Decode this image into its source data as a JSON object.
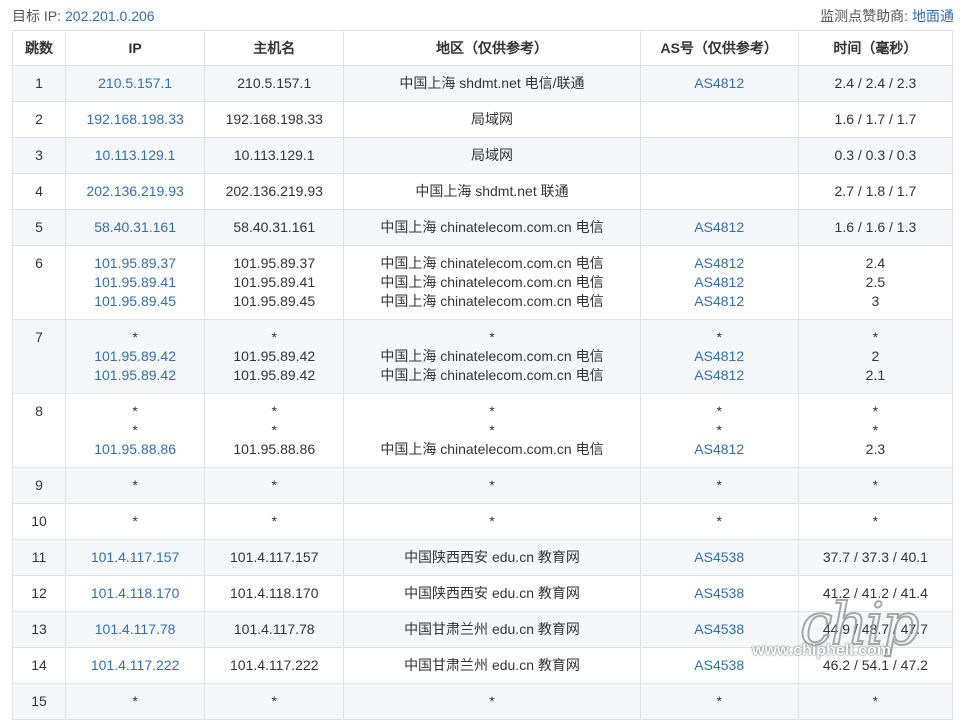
{
  "header": {
    "target_label": "目标 IP:",
    "target_ip": "202.201.0.206",
    "sponsor_label": "监测点赞助商:",
    "sponsor_name": "地面通"
  },
  "columns": [
    "跳数",
    "IP",
    "主机名",
    "地区（仅供参考）",
    "AS号（仅供参考）",
    "时间（毫秒）"
  ],
  "rows": [
    {
      "hop": "1",
      "lines": [
        {
          "ip": "210.5.157.1",
          "host": "210.5.157.1",
          "region": "中国上海 shdmt.net 电信/联通",
          "as": "AS4812",
          "time": "2.4 / 2.4 / 2.3"
        }
      ]
    },
    {
      "hop": "2",
      "lines": [
        {
          "ip": "192.168.198.33",
          "host": "192.168.198.33",
          "region": "局域网",
          "as": "",
          "time": "1.6 / 1.7 / 1.7"
        }
      ]
    },
    {
      "hop": "3",
      "lines": [
        {
          "ip": "10.113.129.1",
          "host": "10.113.129.1",
          "region": "局域网",
          "as": "",
          "time": "0.3 / 0.3 / 0.3"
        }
      ]
    },
    {
      "hop": "4",
      "lines": [
        {
          "ip": "202.136.219.93",
          "host": "202.136.219.93",
          "region": "中国上海 shdmt.net 联通",
          "as": "",
          "time": "2.7 / 1.8 / 1.7"
        }
      ]
    },
    {
      "hop": "5",
      "lines": [
        {
          "ip": "58.40.31.161",
          "host": "58.40.31.161",
          "region": "中国上海 chinatelecom.com.cn 电信",
          "as": "AS4812",
          "time": "1.6 / 1.6 / 1.3"
        }
      ]
    },
    {
      "hop": "6",
      "lines": [
        {
          "ip": "101.95.89.37",
          "host": "101.95.89.37",
          "region": "中国上海 chinatelecom.com.cn 电信",
          "as": "AS4812",
          "time": "2.4"
        },
        {
          "ip": "101.95.89.41",
          "host": "101.95.89.41",
          "region": "中国上海 chinatelecom.com.cn 电信",
          "as": "AS4812",
          "time": "2.5"
        },
        {
          "ip": "101.95.89.45",
          "host": "101.95.89.45",
          "region": "中国上海 chinatelecom.com.cn 电信",
          "as": "AS4812",
          "time": "3"
        }
      ]
    },
    {
      "hop": "7",
      "lines": [
        {
          "ip": "*",
          "host": "*",
          "region": "*",
          "as": "*",
          "time": "*"
        },
        {
          "ip": "101.95.89.42",
          "host": "101.95.89.42",
          "region": "中国上海 chinatelecom.com.cn 电信",
          "as": "AS4812",
          "time": "2"
        },
        {
          "ip": "101.95.89.42",
          "host": "101.95.89.42",
          "region": "中国上海 chinatelecom.com.cn 电信",
          "as": "AS4812",
          "time": "2.1"
        }
      ]
    },
    {
      "hop": "8",
      "lines": [
        {
          "ip": "*",
          "host": "*",
          "region": "*",
          "as": "*",
          "time": "*"
        },
        {
          "ip": "*",
          "host": "*",
          "region": "*",
          "as": "*",
          "time": "*"
        },
        {
          "ip": "101.95.88.86",
          "host": "101.95.88.86",
          "region": "中国上海 chinatelecom.com.cn 电信",
          "as": "AS4812",
          "time": "2.3"
        }
      ]
    },
    {
      "hop": "9",
      "lines": [
        {
          "ip": "*",
          "host": "*",
          "region": "*",
          "as": "*",
          "time": "*"
        }
      ]
    },
    {
      "hop": "10",
      "lines": [
        {
          "ip": "*",
          "host": "*",
          "region": "*",
          "as": "*",
          "time": "*"
        }
      ]
    },
    {
      "hop": "11",
      "lines": [
        {
          "ip": "101.4.117.157",
          "host": "101.4.117.157",
          "region": "中国陕西西安 edu.cn 教育网",
          "as": "AS4538",
          "time": "37.7 / 37.3 / 40.1"
        }
      ]
    },
    {
      "hop": "12",
      "lines": [
        {
          "ip": "101.4.118.170",
          "host": "101.4.118.170",
          "region": "中国陕西西安 edu.cn 教育网",
          "as": "AS4538",
          "time": "41.2 / 41.2 / 41.4"
        }
      ]
    },
    {
      "hop": "13",
      "lines": [
        {
          "ip": "101.4.117.78",
          "host": "101.4.117.78",
          "region": "中国甘肃兰州 edu.cn 教育网",
          "as": "AS4538",
          "time": "44.9 / 48.7 / 47.7"
        }
      ]
    },
    {
      "hop": "14",
      "lines": [
        {
          "ip": "101.4.117.222",
          "host": "101.4.117.222",
          "region": "中国甘肃兰州 edu.cn 教育网",
          "as": "AS4538",
          "time": "46.2 / 54.1 / 47.2"
        }
      ]
    },
    {
      "hop": "15",
      "lines": [
        {
          "ip": "*",
          "host": "*",
          "region": "*",
          "as": "*",
          "time": "*"
        }
      ]
    }
  ],
  "watermark": {
    "logo_text": "chip",
    "url": "www.chiphell.com"
  }
}
